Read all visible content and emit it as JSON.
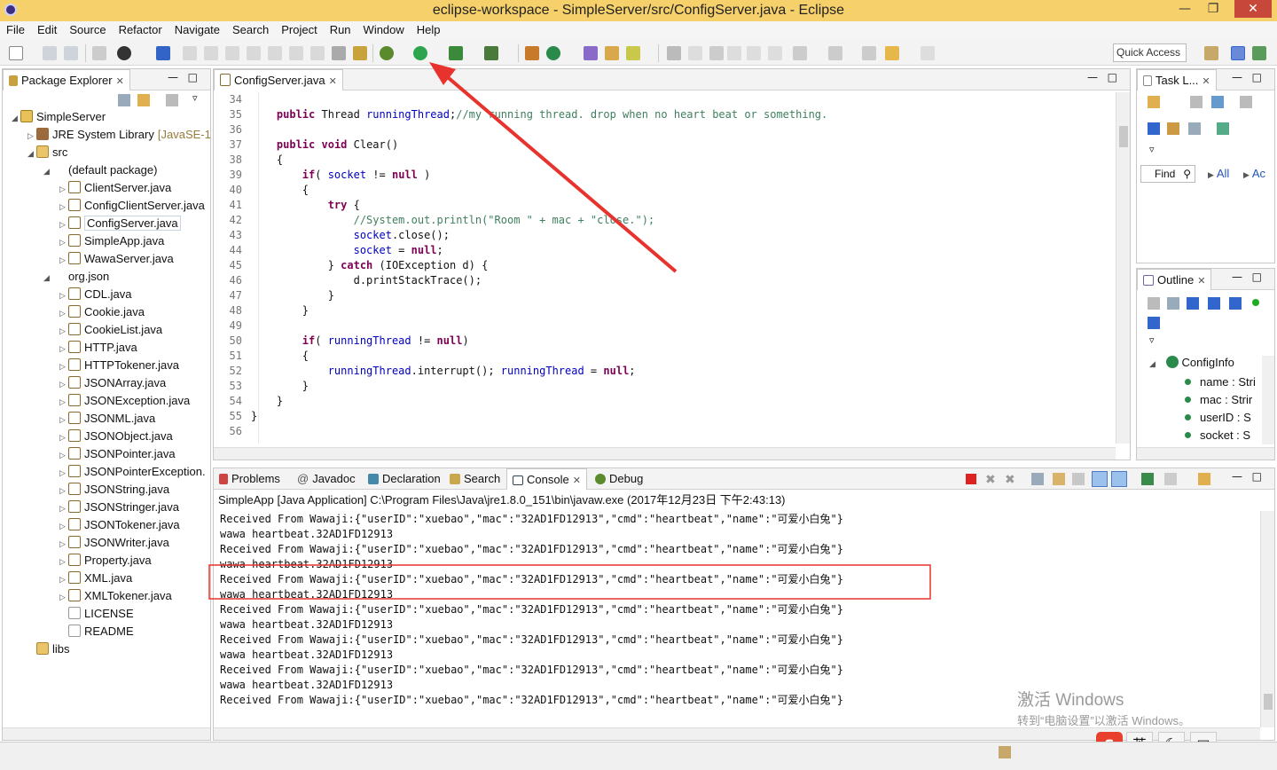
{
  "window": {
    "title": "eclipse-workspace - SimpleServer/src/ConfigServer.java - Eclipse"
  },
  "menu": [
    "File",
    "Edit",
    "Source",
    "Refactor",
    "Navigate",
    "Search",
    "Project",
    "Run",
    "Window",
    "Help"
  ],
  "toolbar": {
    "quick_access": "Quick Access"
  },
  "package_explorer": {
    "title": "Package Explorer",
    "items": [
      {
        "label": "SimpleServer",
        "kind": "project"
      },
      {
        "label": "JRE System Library",
        "suffix": "[JavaSE-1",
        "kind": "jre"
      },
      {
        "label": "src",
        "kind": "folder"
      },
      {
        "label": "(default package)",
        "kind": "package"
      },
      {
        "label": "ClientServer.java",
        "kind": "java"
      },
      {
        "label": "ConfigClientServer.java",
        "kind": "java"
      },
      {
        "label": "ConfigServer.java",
        "kind": "java"
      },
      {
        "label": "SimpleApp.java",
        "kind": "java"
      },
      {
        "label": "WawaServer.java",
        "kind": "java"
      },
      {
        "label": "org.json",
        "kind": "package"
      },
      {
        "label": "CDL.java",
        "kind": "java"
      },
      {
        "label": "Cookie.java",
        "kind": "java"
      },
      {
        "label": "CookieList.java",
        "kind": "java"
      },
      {
        "label": "HTTP.java",
        "kind": "java"
      },
      {
        "label": "HTTPTokener.java",
        "kind": "java"
      },
      {
        "label": "JSONArray.java",
        "kind": "java"
      },
      {
        "label": "JSONException.java",
        "kind": "java"
      },
      {
        "label": "JSONML.java",
        "kind": "java"
      },
      {
        "label": "JSONObject.java",
        "kind": "java"
      },
      {
        "label": "JSONPointer.java",
        "kind": "java"
      },
      {
        "label": "JSONPointerException.",
        "kind": "java"
      },
      {
        "label": "JSONString.java",
        "kind": "java"
      },
      {
        "label": "JSONStringer.java",
        "kind": "java"
      },
      {
        "label": "JSONTokener.java",
        "kind": "java"
      },
      {
        "label": "JSONWriter.java",
        "kind": "java"
      },
      {
        "label": "Property.java",
        "kind": "java"
      },
      {
        "label": "XML.java",
        "kind": "java"
      },
      {
        "label": "XMLTokener.java",
        "kind": "java"
      },
      {
        "label": "LICENSE",
        "kind": "file"
      },
      {
        "label": "README",
        "kind": "file"
      },
      {
        "label": "libs",
        "kind": "folder"
      }
    ]
  },
  "editor": {
    "tab": "ConfigServer.java",
    "lines": [
      {
        "n": "34",
        "html": ""
      },
      {
        "n": "35",
        "html": "    <span class=\"kw\">public</span> Thread <span class=\"fld\">runningThread</span>;<span class=\"cm\">//my running thread. drop when no heart beat or something.</span>"
      },
      {
        "n": "36",
        "html": ""
      },
      {
        "n": "37",
        "html": "    <span class=\"kw\">public</span> <span class=\"kw\">void</span> Clear()"
      },
      {
        "n": "38",
        "html": "    {"
      },
      {
        "n": "39",
        "html": "        <span class=\"kw\">if</span>( <span class=\"fld\">socket</span> != <span class=\"kw\">null</span> )"
      },
      {
        "n": "40",
        "html": "        {"
      },
      {
        "n": "41",
        "html": "            <span class=\"kw\">try</span> {"
      },
      {
        "n": "42",
        "html": "                <span class=\"cm\">//System.out.println(\"Room \" + mac + \"close.\");</span>"
      },
      {
        "n": "43",
        "html": "                <span class=\"fld\">socket</span>.close();"
      },
      {
        "n": "44",
        "html": "                <span class=\"fld\">socket</span> = <span class=\"kw\">null</span>;"
      },
      {
        "n": "45",
        "html": "            } <span class=\"kw\">catch</span> (IOException d) {"
      },
      {
        "n": "46",
        "html": "                d.printStackTrace();"
      },
      {
        "n": "47",
        "html": "            }"
      },
      {
        "n": "48",
        "html": "        }"
      },
      {
        "n": "49",
        "html": ""
      },
      {
        "n": "50",
        "html": "        <span class=\"kw\">if</span>( <span class=\"fld\">runningThread</span> != <span class=\"kw\">null</span>)"
      },
      {
        "n": "51",
        "html": "        {"
      },
      {
        "n": "52",
        "html": "            <span class=\"fld\">runningThread</span>.interrupt(); <span class=\"fld\">runningThread</span> = <span class=\"kw\">null</span>;"
      },
      {
        "n": "53",
        "html": "        }"
      },
      {
        "n": "54",
        "html": "    }"
      },
      {
        "n": "55",
        "html": "}"
      },
      {
        "n": "56",
        "html": ""
      }
    ]
  },
  "task_list": {
    "title": "Task L...",
    "find": "Find",
    "all": "All",
    "ac": "Ac"
  },
  "outline": {
    "title": "Outline",
    "root": "ConfigInfo",
    "fields": [
      "name : Stri",
      "mac : Strir",
      "userID : S",
      "socket : S"
    ]
  },
  "bottom": {
    "tabs": [
      "Problems",
      "Javadoc",
      "Declaration",
      "Search",
      "Console",
      "Debug"
    ],
    "active_tab": "Console",
    "process": "SimpleApp [Java Application] C:\\Program Files\\Java\\jre1.8.0_151\\bin\\javaw.exe (2017年12月23日 下午2:43:13)",
    "lines": [
      "Received From Wawaji:{\"userID\":\"xuebao\",\"mac\":\"32AD1FD12913\",\"cmd\":\"heartbeat\",\"name\":\"可爱小白兔\"}",
      "wawa heartbeat.32AD1FD12913",
      "Received From Wawaji:{\"userID\":\"xuebao\",\"mac\":\"32AD1FD12913\",\"cmd\":\"heartbeat\",\"name\":\"可爱小白兔\"}",
      "wawa heartbeat.32AD1FD12913",
      "Received From Wawaji:{\"userID\":\"xuebao\",\"mac\":\"32AD1FD12913\",\"cmd\":\"heartbeat\",\"name\":\"可爱小白兔\"}",
      "wawa heartbeat.32AD1FD12913",
      "Received From Wawaji:{\"userID\":\"xuebao\",\"mac\":\"32AD1FD12913\",\"cmd\":\"heartbeat\",\"name\":\"可爱小白兔\"}",
      "wawa heartbeat.32AD1FD12913",
      "Received From Wawaji:{\"userID\":\"xuebao\",\"mac\":\"32AD1FD12913\",\"cmd\":\"heartbeat\",\"name\":\"可爱小白兔\"}",
      "wawa heartbeat.32AD1FD12913",
      "Received From Wawaji:{\"userID\":\"xuebao\",\"mac\":\"32AD1FD12913\",\"cmd\":\"heartbeat\",\"name\":\"可爱小白兔\"}",
      "wawa heartbeat.32AD1FD12913",
      "Received From Wawaji:{\"userID\":\"xuebao\",\"mac\":\"32AD1FD12913\",\"cmd\":\"heartbeat\",\"name\":\"可爱小白兔\"}"
    ]
  },
  "watermark": {
    "line1": "激活 Windows",
    "line2": "转到“电脑设置”以激活 Windows。"
  },
  "ime": {
    "lang": "英"
  },
  "colors": {
    "title_bar": "#f6d16b",
    "annotation_red": "#e8322d",
    "keyword": "#7f0055",
    "field": "#0000c0",
    "comment": "#3f7f5f"
  }
}
